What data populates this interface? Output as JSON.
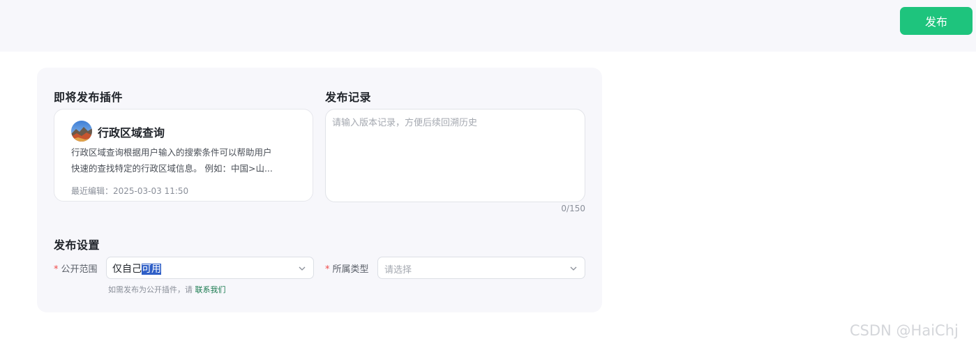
{
  "header": {
    "publish_label": "发布"
  },
  "plugin_section": {
    "title": "即将发布插件",
    "plugin": {
      "name": "行政区域查询",
      "description_line1": "行政区域查询根据用户输入的搜索条件可以帮助用户",
      "description_line2": "快速的查找特定的行政区域信息。 例如：中国>山...",
      "last_edited": "最近编辑：2025-03-03 11:50",
      "avatar_icon": "landscape-photo-avatar"
    }
  },
  "record_section": {
    "title": "发布记录",
    "placeholder": "请输入版本记录，方便后续回溯历史",
    "counter": "0/150"
  },
  "settings_section": {
    "title": "发布设置",
    "visibility": {
      "label": "公开范围",
      "required_mark": "*",
      "value_prefix": "仅自己",
      "value_highlighted": "可用",
      "icon": "chevron-down-icon"
    },
    "category": {
      "label": "所属类型",
      "required_mark": "*",
      "placeholder": "请选择",
      "icon": "chevron-down-icon"
    },
    "hint_text": "如需发布为公开插件，请",
    "hint_link": "联系我们"
  },
  "watermark": "CSDN @HaiChj",
  "colors": {
    "accent": "#1ec47d",
    "link": "#197a4f",
    "required": "#f04848",
    "selection": "#2f5fc7"
  }
}
